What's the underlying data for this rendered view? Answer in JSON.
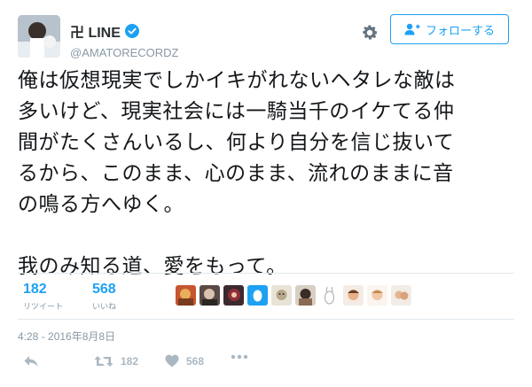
{
  "user": {
    "display_name": "卍 LINE",
    "handle": "@AMATORECORDZ",
    "verified": true,
    "avatar_icon": "user-avatar"
  },
  "follow_button": {
    "label": "フォローする",
    "icon": "add-user-icon",
    "color": "#1da1f2"
  },
  "settings_icon": "gear-icon",
  "tweet": {
    "text": "俺は仮想現実でしかイキがれないヘタレな敵は\n多いけど、現実社会には一騎当千のイケてる仲\n間がたくさんいるし、何より自分を信じ抜いて\nるから、このまま、心のまま、流れのままに音\nの鳴る方へゆく。\n\n我のみ知る道、愛をもって。"
  },
  "stats": {
    "retweets": {
      "count": "182",
      "label": "リツイート"
    },
    "likes": {
      "count": "568",
      "label": "いいね"
    }
  },
  "likers_count": 10,
  "timestamp": "4:28 - 2016年8月8日",
  "actions": {
    "reply": {
      "icon": "reply-icon"
    },
    "retweet": {
      "icon": "retweet-icon",
      "count": "182"
    },
    "like": {
      "icon": "heart-icon",
      "count": "568"
    },
    "more": {
      "icon": "more-icon"
    }
  },
  "colors": {
    "accent": "#1da1f2",
    "muted": "#8899a6",
    "icon_gray": "#aab8c2",
    "divider": "#e1e8ed"
  }
}
